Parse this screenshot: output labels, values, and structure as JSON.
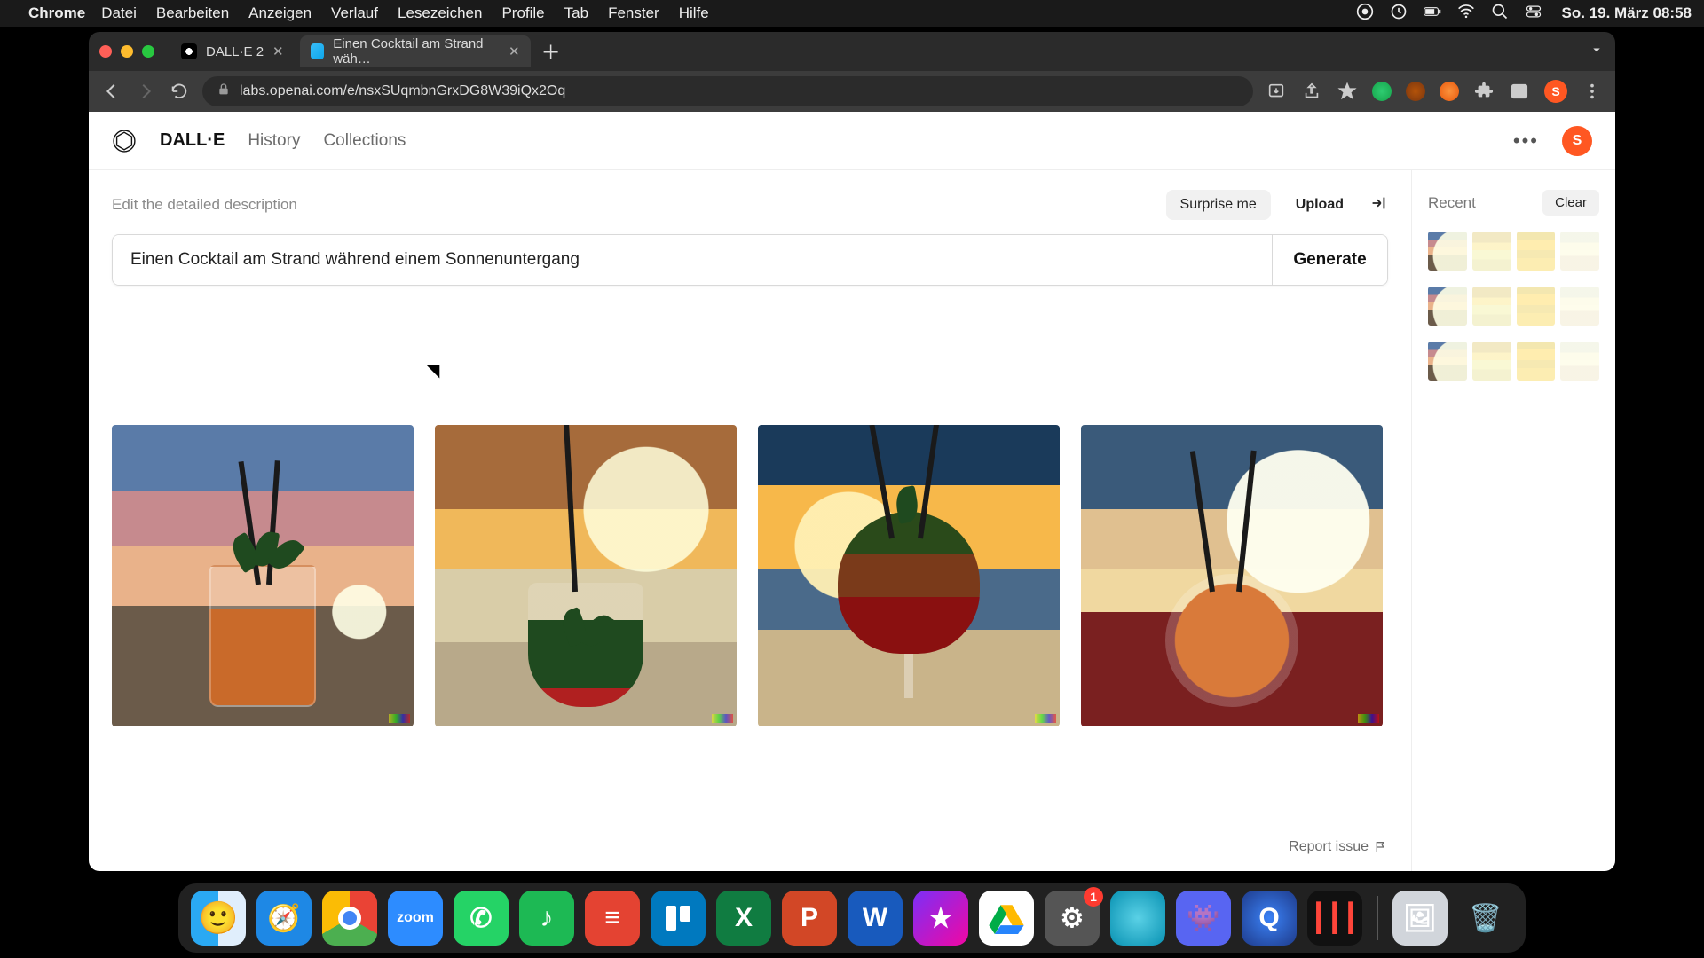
{
  "menubar": {
    "app": "Chrome",
    "items": [
      "Datei",
      "Bearbeiten",
      "Anzeigen",
      "Verlauf",
      "Lesezeichen",
      "Profile",
      "Tab",
      "Fenster",
      "Hilfe"
    ],
    "clock": "So. 19. März  08:58"
  },
  "tabs": {
    "t1": "DALL·E 2",
    "t2": "Einen Cocktail am Strand wäh…"
  },
  "omnibox": {
    "url": "labs.openai.com/e/nsxSUqmbnGrxDG8W39iQx2Oq"
  },
  "avatar_letter": "S",
  "nav": {
    "title": "DALL·E",
    "history": "History",
    "collections": "Collections"
  },
  "prompt": {
    "hint": "Edit the detailed description",
    "surprise": "Surprise me",
    "upload": "Upload",
    "value": "Einen Cocktail am Strand während einem Sonnenuntergang",
    "generate": "Generate"
  },
  "report": "Report issue",
  "sidebar": {
    "title": "Recent",
    "clear": "Clear"
  },
  "dock": {
    "settings_badge": "1"
  }
}
